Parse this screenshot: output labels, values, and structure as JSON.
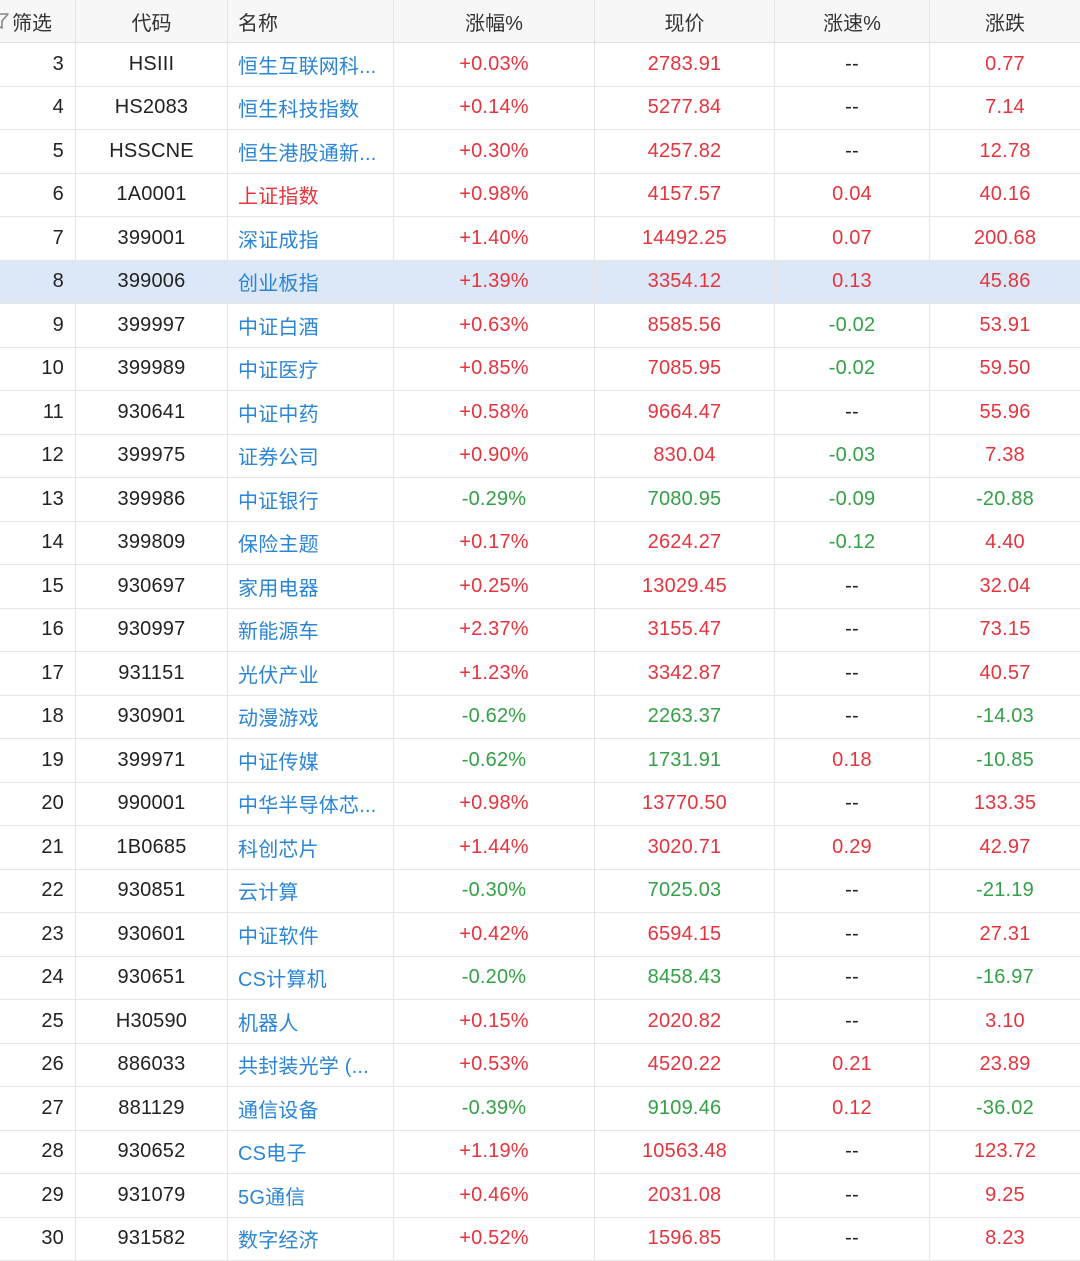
{
  "header": {
    "filter_label": "筛选",
    "columns": [
      "代码",
      "名称",
      "涨幅%",
      "现价",
      "涨速%",
      "涨跌"
    ]
  },
  "colors": {
    "up": "#e5343d",
    "down": "#34a047",
    "flat": "#222222",
    "link": "#2b85d6",
    "selected_row": "#dce8f7"
  },
  "icons": {
    "filter": "filter-icon"
  },
  "rows": [
    {
      "no": "3",
      "code": "HSIII",
      "name": "恒生互联网科...",
      "pct": "+0.03%",
      "price": "2783.91",
      "speed": "--",
      "change": "0.77"
    },
    {
      "no": "4",
      "code": "HS2083",
      "name": "恒生科技指数",
      "pct": "+0.14%",
      "price": "5277.84",
      "speed": "--",
      "change": "7.14"
    },
    {
      "no": "5",
      "code": "HSSCNE",
      "name": "恒生港股通新...",
      "pct": "+0.30%",
      "price": "4257.82",
      "speed": "--",
      "change": "12.78"
    },
    {
      "no": "6",
      "code": "1A0001",
      "name": "上证指数",
      "name_color": "up",
      "pct": "+0.98%",
      "price": "4157.57",
      "speed": "0.04",
      "change": "40.16"
    },
    {
      "no": "7",
      "code": "399001",
      "name": "深证成指",
      "pct": "+1.40%",
      "price": "14492.25",
      "speed": "0.07",
      "change": "200.68"
    },
    {
      "no": "8",
      "code": "399006",
      "name": "创业板指",
      "selected": true,
      "pct": "+1.39%",
      "price": "3354.12",
      "speed": "0.13",
      "change": "45.86"
    },
    {
      "no": "9",
      "code": "399997",
      "name": "中证白酒",
      "pct": "+0.63%",
      "price": "8585.56",
      "speed": "-0.02",
      "change": "53.91"
    },
    {
      "no": "10",
      "code": "399989",
      "name": "中证医疗",
      "pct": "+0.85%",
      "price": "7085.95",
      "speed": "-0.02",
      "change": "59.50"
    },
    {
      "no": "11",
      "code": "930641",
      "name": "中证中药",
      "pct": "+0.58%",
      "price": "9664.47",
      "speed": "--",
      "change": "55.96"
    },
    {
      "no": "12",
      "code": "399975",
      "name": "证券公司",
      "pct": "+0.90%",
      "price": "830.04",
      "speed": "-0.03",
      "change": "7.38"
    },
    {
      "no": "13",
      "code": "399986",
      "name": "中证银行",
      "pct": "-0.29%",
      "price": "7080.95",
      "speed": "-0.09",
      "change": "-20.88"
    },
    {
      "no": "14",
      "code": "399809",
      "name": "保险主题",
      "pct": "+0.17%",
      "price": "2624.27",
      "speed": "-0.12",
      "change": "4.40"
    },
    {
      "no": "15",
      "code": "930697",
      "name": "家用电器",
      "pct": "+0.25%",
      "price": "13029.45",
      "speed": "--",
      "change": "32.04"
    },
    {
      "no": "16",
      "code": "930997",
      "name": "新能源车",
      "pct": "+2.37%",
      "price": "3155.47",
      "speed": "--",
      "change": "73.15"
    },
    {
      "no": "17",
      "code": "931151",
      "name": "光伏产业",
      "pct": "+1.23%",
      "price": "3342.87",
      "speed": "--",
      "change": "40.57"
    },
    {
      "no": "18",
      "code": "930901",
      "name": "动漫游戏",
      "pct": "-0.62%",
      "price": "2263.37",
      "speed": "--",
      "change": "-14.03"
    },
    {
      "no": "19",
      "code": "399971",
      "name": "中证传媒",
      "pct": "-0.62%",
      "price": "1731.91",
      "speed": "0.18",
      "change": "-10.85"
    },
    {
      "no": "20",
      "code": "990001",
      "name": "中华半导体芯...",
      "pct": "+0.98%",
      "price": "13770.50",
      "speed": "--",
      "change": "133.35"
    },
    {
      "no": "21",
      "code": "1B0685",
      "name": "科创芯片",
      "pct": "+1.44%",
      "price": "3020.71",
      "speed": "0.29",
      "change": "42.97"
    },
    {
      "no": "22",
      "code": "930851",
      "name": "云计算",
      "pct": "-0.30%",
      "price": "7025.03",
      "speed": "--",
      "change": "-21.19"
    },
    {
      "no": "23",
      "code": "930601",
      "name": "中证软件",
      "pct": "+0.42%",
      "price": "6594.15",
      "speed": "--",
      "change": "27.31"
    },
    {
      "no": "24",
      "code": "930651",
      "name": "CS计算机",
      "pct": "-0.20%",
      "price": "8458.43",
      "speed": "--",
      "change": "-16.97"
    },
    {
      "no": "25",
      "code": "H30590",
      "name": "机器人",
      "pct": "+0.15%",
      "price": "2020.82",
      "speed": "--",
      "change": "3.10"
    },
    {
      "no": "26",
      "code": "886033",
      "name": "共封装光学 (...",
      "pct": "+0.53%",
      "price": "4520.22",
      "speed": "0.21",
      "change": "23.89"
    },
    {
      "no": "27",
      "code": "881129",
      "name": "通信设备",
      "pct": "-0.39%",
      "price": "9109.46",
      "speed": "0.12",
      "change": "-36.02"
    },
    {
      "no": "28",
      "code": "930652",
      "name": "CS电子",
      "pct": "+1.19%",
      "price": "10563.48",
      "speed": "--",
      "change": "123.72"
    },
    {
      "no": "29",
      "code": "931079",
      "name": "5G通信",
      "pct": "+0.46%",
      "price": "2031.08",
      "speed": "--",
      "change": "9.25"
    },
    {
      "no": "30",
      "code": "931582",
      "name": "数字经济",
      "pct": "+0.52%",
      "price": "1596.85",
      "speed": "--",
      "change": "8.23"
    }
  ]
}
